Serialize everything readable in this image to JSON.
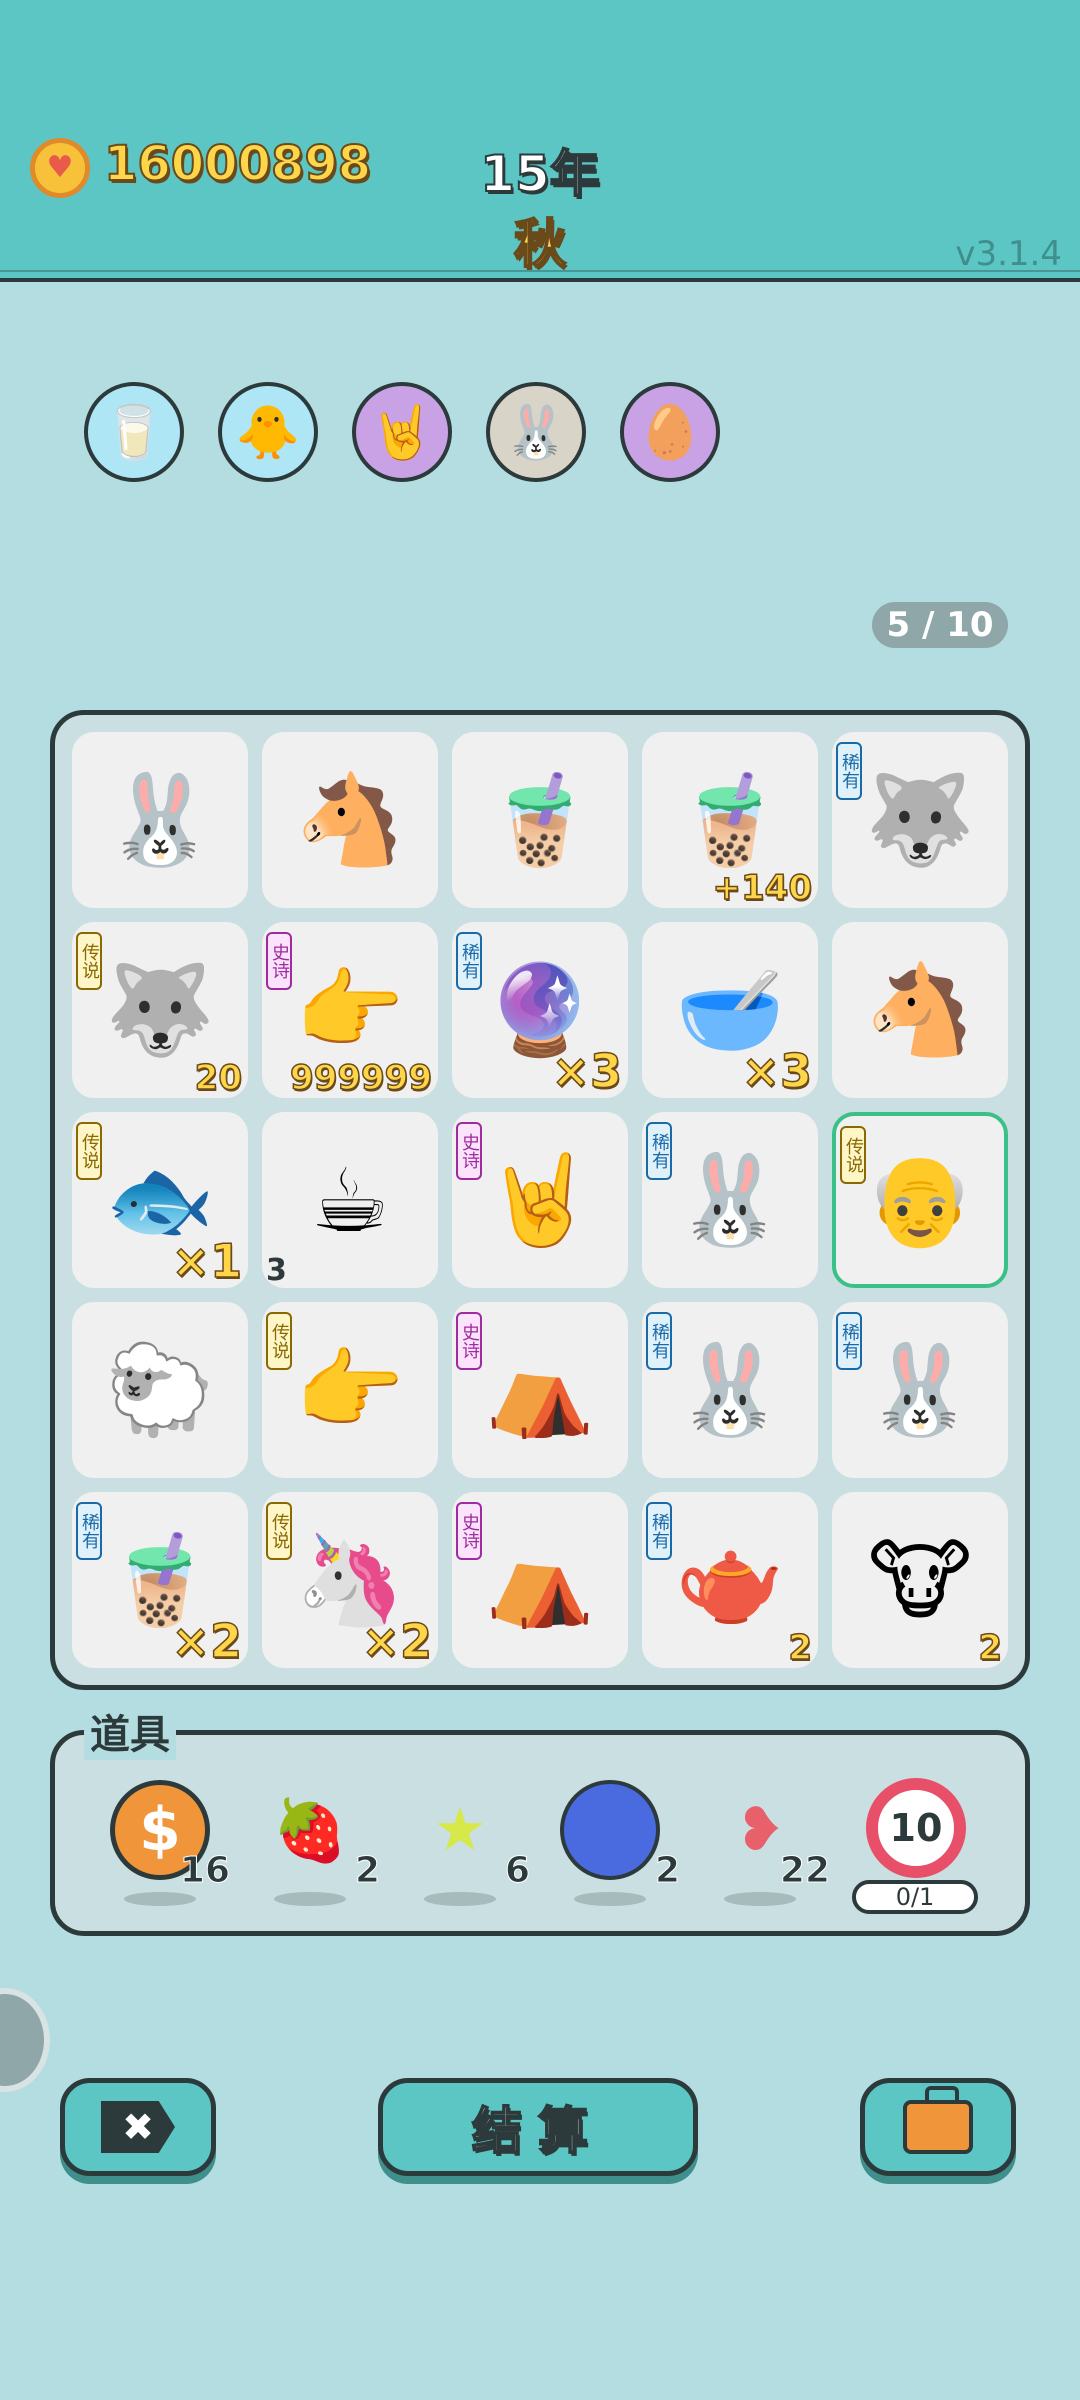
{
  "header": {
    "coins": "16000898",
    "year": "15年",
    "season": "秋",
    "version": "v3.1.4"
  },
  "buffs": [
    {
      "icon": "milk-jug-icon",
      "color": "#aee6f6"
    },
    {
      "icon": "syringe-chick-icon",
      "color": "#aee6f6"
    },
    {
      "icon": "rock-hand-icon",
      "color": "#c9a2e6"
    },
    {
      "icon": "bunny-icon",
      "color": "#d9d4c8"
    },
    {
      "icon": "egg-icon",
      "color": "#c9a2e6"
    }
  ],
  "board": {
    "counter": "5 / 10",
    "cells": [
      {
        "icon": "bunny-icon",
        "tag": "",
        "count": ""
      },
      {
        "icon": "horse-icon",
        "tag": "",
        "count": ""
      },
      {
        "icon": "milk-tea-icon",
        "tag": "",
        "count": ""
      },
      {
        "icon": "milk-tea-icon",
        "tag": "",
        "count": "+140"
      },
      {
        "icon": "husky-icon",
        "tag": "稀有",
        "count": ""
      },
      {
        "icon": "king-husky-icon",
        "tag": "传说",
        "count": "20"
      },
      {
        "icon": "pointing-hand-icon",
        "tag": "史诗",
        "count": "999999"
      },
      {
        "icon": "capsule-ball-icon",
        "tag": "稀有",
        "count": "×3"
      },
      {
        "icon": "soup-bowl-icon",
        "tag": "",
        "count": "×3"
      },
      {
        "icon": "horse-icon",
        "tag": "",
        "count": ""
      },
      {
        "icon": "koi-fish-icon",
        "tag": "传说",
        "count": "×1"
      },
      {
        "icon": "coffee-cup-icon",
        "tag": "",
        "count": "3"
      },
      {
        "icon": "rock-hand-icon",
        "tag": "史诗",
        "count": ""
      },
      {
        "icon": "bunny-icon",
        "tag": "稀有",
        "count": ""
      },
      {
        "icon": "grandpa-face-icon",
        "tag": "传说",
        "count": ""
      },
      {
        "icon": "sheep-icon",
        "tag": "",
        "count": ""
      },
      {
        "icon": "yellow-hand-icon",
        "tag": "传说",
        "count": ""
      },
      {
        "icon": "bunny-tent-icon",
        "tag": "史诗",
        "count": ""
      },
      {
        "icon": "bunny-icon",
        "tag": "稀有",
        "count": ""
      },
      {
        "icon": "bunny-icon",
        "tag": "稀有",
        "count": ""
      },
      {
        "icon": "milk-tea-icon",
        "tag": "稀有",
        "count": "×2"
      },
      {
        "icon": "unicorn-icon",
        "tag": "传说",
        "count": "×2"
      },
      {
        "icon": "bunny-tent-icon",
        "tag": "史诗",
        "count": ""
      },
      {
        "icon": "teapot-icon",
        "tag": "稀有",
        "count": "2"
      },
      {
        "icon": "cow-icon",
        "tag": "",
        "count": "2"
      }
    ]
  },
  "items": {
    "label": "道具",
    "list": [
      {
        "icon": "dollar-coin-icon",
        "qty": "16",
        "color": "#f0953a"
      },
      {
        "icon": "strawberry-icon",
        "qty": "2",
        "color": "#e84a4a"
      },
      {
        "icon": "star-icon",
        "qty": "6",
        "color": "#d6e84a"
      },
      {
        "icon": "blueberry-icon",
        "qty": "2",
        "color": "#4a6ae0"
      },
      {
        "icon": "liver-icon",
        "qty": "22",
        "color": "#e8606a"
      }
    ],
    "target": {
      "icon": "target-icon",
      "value": "10",
      "progress": "0/1"
    }
  },
  "buttons": {
    "close": "✖",
    "settle": "结算",
    "bag": "briefcase-icon"
  }
}
